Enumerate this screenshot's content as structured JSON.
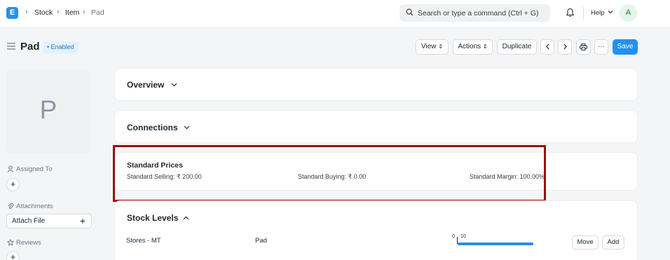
{
  "navbar": {
    "logo_letter": "E",
    "breadcrumbs": [
      "Stock",
      "Item",
      "Pad"
    ],
    "search_placeholder": "Search or type a command (Ctrl + G)",
    "help_label": "Help",
    "avatar_initial": "A"
  },
  "header": {
    "title": "Pad",
    "status": "• Enabled",
    "buttons": {
      "view": "View",
      "actions": "Actions",
      "duplicate": "Duplicate",
      "more": "···",
      "save": "Save"
    }
  },
  "sidebar": {
    "image_letter": "P",
    "assigned_to": "Assigned To",
    "attachments": "Attachments",
    "attach_file": "Attach File",
    "reviews": "Reviews"
  },
  "sections": {
    "overview": "Overview",
    "connections": "Connections",
    "standard_prices": {
      "title": "Standard Prices",
      "selling": "Standard Selling: ₹ 200.00",
      "buying": "Standard Buying: ₹ 0.00",
      "margin": "Standard Margin: 100.00%"
    },
    "stock_levels": {
      "title": "Stock Levels",
      "rows": [
        {
          "warehouse": "Stores - MT",
          "item": "Pad",
          "min_label": "0",
          "max_label": "10",
          "fill_fraction": 1.0,
          "move_label": "Move",
          "add_label": "Add"
        }
      ]
    }
  },
  "colors": {
    "accent": "#2490ef",
    "highlight": "#a30a0a",
    "enabled_badge": "#e2f1fd"
  }
}
